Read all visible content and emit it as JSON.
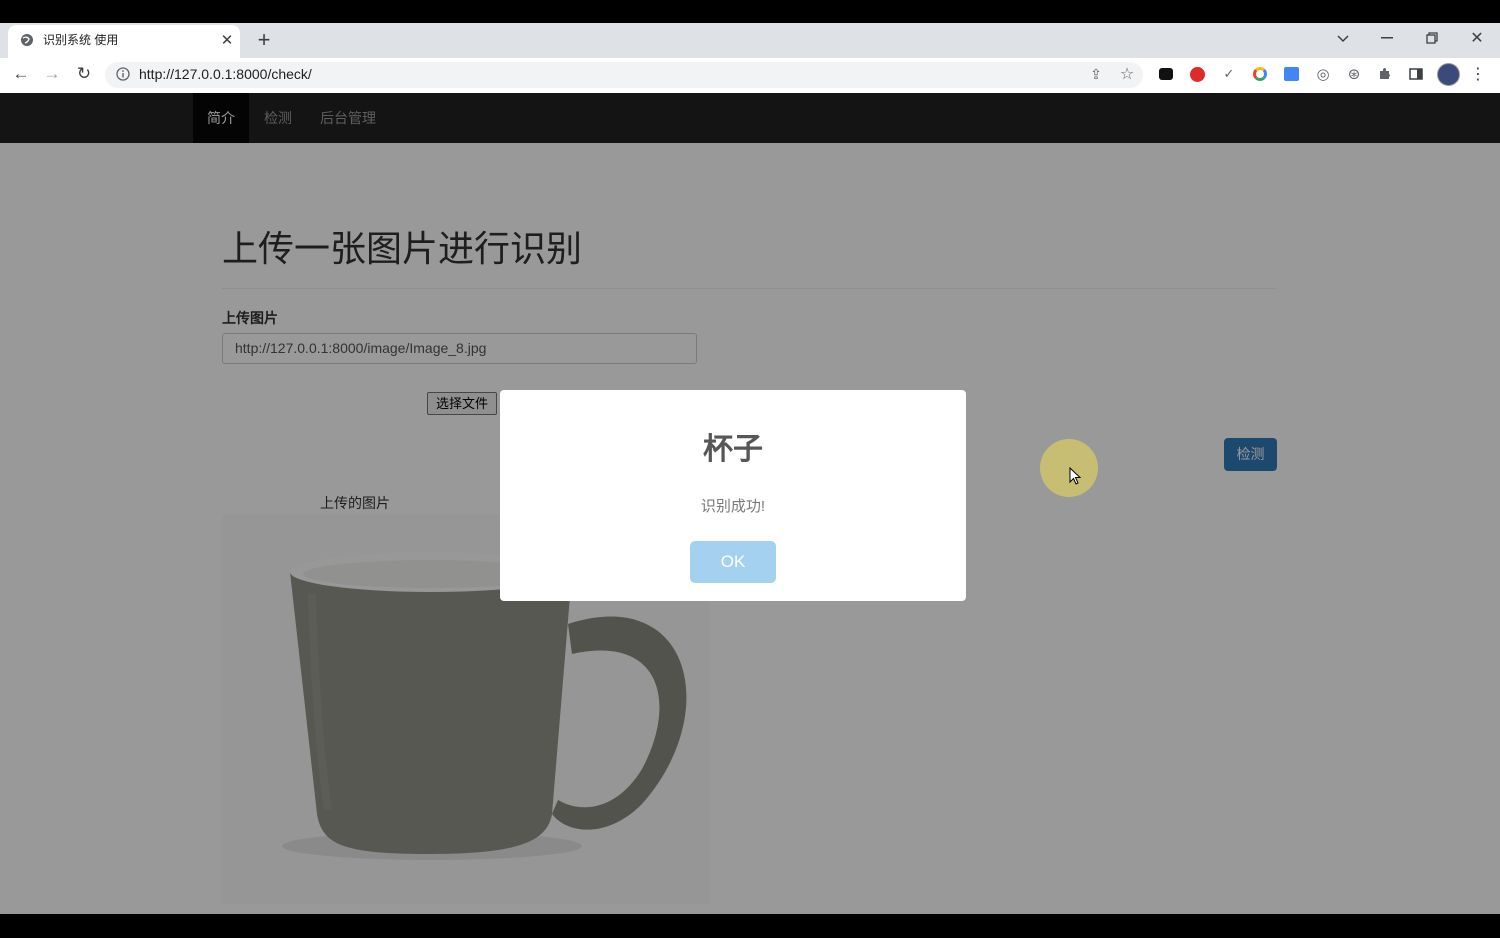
{
  "browser": {
    "tab_title": "识别系统 使用",
    "new_tab_symbol": "+",
    "url": "http://127.0.0.1:8000/check/"
  },
  "navbar": {
    "items": [
      {
        "label": "简介",
        "active": true
      },
      {
        "label": "检测",
        "active": false
      },
      {
        "label": "后台管理",
        "active": false
      }
    ]
  },
  "main": {
    "heading": "上传一张图片进行识别",
    "upload_label": "上传图片",
    "image_url_value": "http://127.0.0.1:8000/image/Image_8.jpg",
    "file_button": "选择文件",
    "detect_button": "检测",
    "uploaded_caption": "上传的图片"
  },
  "modal": {
    "title": "杯子",
    "text": "识别成功!",
    "ok": "OK"
  },
  "colors": {
    "navbar": "#222222",
    "primary_button": "#337ab7",
    "modal_ok": "#a5d1f0"
  }
}
